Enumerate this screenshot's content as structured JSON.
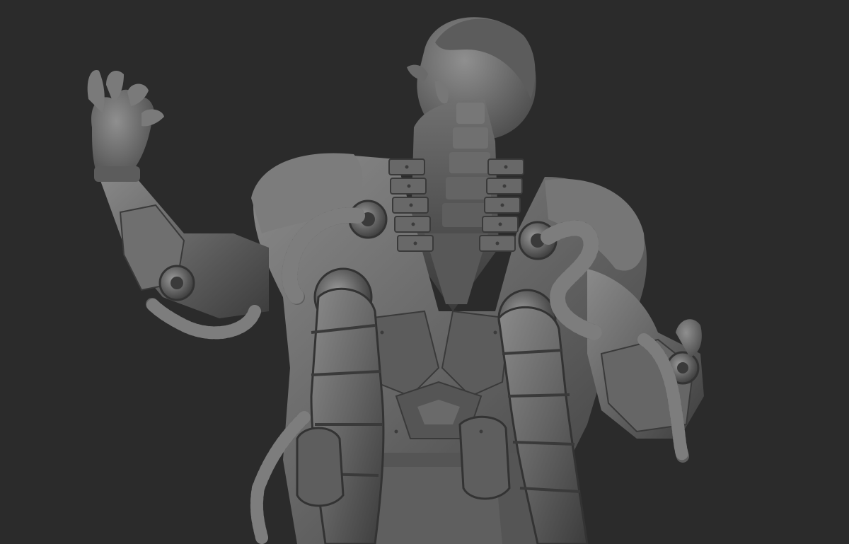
{
  "viewport": {
    "subject": "sculpt-render",
    "background_color": "#2b2b2b",
    "material_color": "#6e6e6e",
    "shadow_color": "#3a3a3a",
    "highlight_color": "#a0a0a0"
  }
}
